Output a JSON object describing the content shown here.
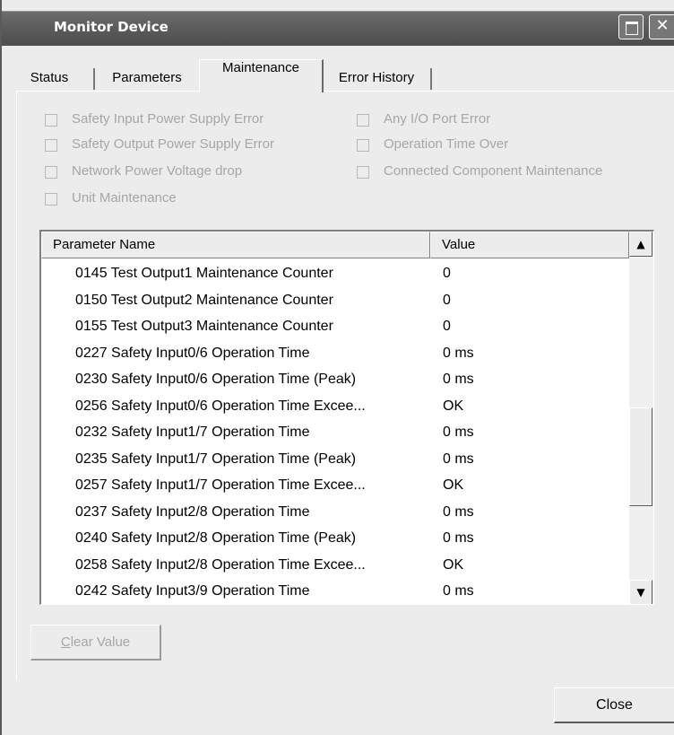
{
  "window": {
    "title": "Monitor Device"
  },
  "tabs": [
    "Status",
    "Parameters",
    "Maintenance",
    "Error History"
  ],
  "active_tab": "Maintenance",
  "checkboxes": [
    {
      "label": "Safety Input Power Supply Error"
    },
    {
      "label": "Any I/O Port Error"
    },
    {
      "label": "Safety Output Power Supply Error"
    },
    {
      "label": "Operation Time Over"
    },
    {
      "label": "Network Power Voltage drop"
    },
    {
      "label": "Connected Component Maintenance"
    },
    {
      "label": "Unit Maintenance"
    }
  ],
  "grid": {
    "col_param": "Parameter Name",
    "col_value": "Value",
    "rows": [
      {
        "name": "0145 Test Output1 Maintenance Counter",
        "value": "0"
      },
      {
        "name": "0150 Test Output2 Maintenance Counter",
        "value": "0"
      },
      {
        "name": "0155 Test Output3 Maintenance Counter",
        "value": "0"
      },
      {
        "name": "0227 Safety Input0/6 Operation Time",
        "value": "0 ms"
      },
      {
        "name": "0230 Safety Input0/6 Operation Time (Peak)",
        "value": "0 ms"
      },
      {
        "name": "0256 Safety Input0/6 Operation Time Excee...",
        "value": "OK"
      },
      {
        "name": "0232 Safety Input1/7 Operation Time",
        "value": "0 ms"
      },
      {
        "name": "0235 Safety Input1/7 Operation Time (Peak)",
        "value": "0 ms"
      },
      {
        "name": "0257 Safety Input1/7 Operation Time Excee...",
        "value": "OK"
      },
      {
        "name": "0237 Safety Input2/8 Operation Time",
        "value": "0 ms"
      },
      {
        "name": "0240 Safety Input2/8 Operation Time (Peak)",
        "value": "0 ms"
      },
      {
        "name": "0258 Safety Input2/8 Operation Time Excee...",
        "value": "OK"
      },
      {
        "name": "0242 Safety Input3/9 Operation Time",
        "value": "0 ms"
      }
    ]
  },
  "buttons": {
    "clear_prefix": "C",
    "clear_rest": "lear Value",
    "close": "Close"
  },
  "icons": {
    "maximize": "maximize-icon",
    "close": "close-icon",
    "scroll_up": "arrow-up-icon",
    "scroll_down": "arrow-down-icon"
  }
}
